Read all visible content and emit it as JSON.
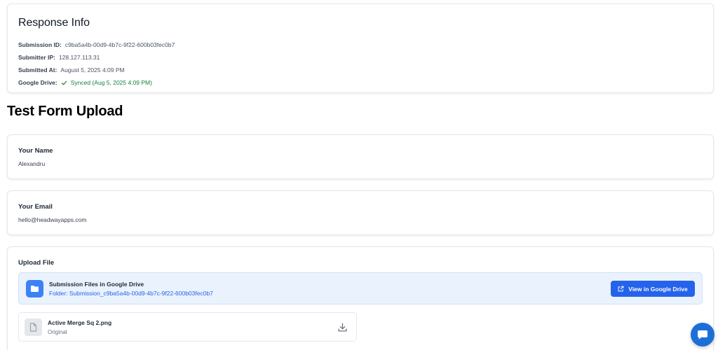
{
  "response_info": {
    "title": "Response Info",
    "rows": [
      {
        "label": "Submission ID:",
        "value": "c9ba5a4b-00d9-4b7c-9f22-600b03fec0b7"
      },
      {
        "label": "Submitter IP:",
        "value": "128.127.113.31"
      },
      {
        "label": "Submitted At:",
        "value": "August 5, 2025 4:09 PM"
      },
      {
        "label": "Google Drive:",
        "value": "Synced (Aug 5, 2025 4:09 PM)"
      }
    ]
  },
  "form": {
    "title": "Test Form Upload",
    "fields": [
      {
        "label": "Your Name",
        "value": "Alexandru"
      },
      {
        "label": "Your Email",
        "value": "hello@headwayapps.com"
      }
    ],
    "upload": {
      "label": "Upload File",
      "drive_title": "Submission Files in Google Drive",
      "drive_folder": "Folder: Submission_c9ba5a4b-00d9-4b7c-9f22-600b03fec0b7",
      "view_button": "View in Google Drive",
      "file_name": "Active Merge Sq 2.png",
      "file_variant": "Original"
    }
  },
  "icons": {
    "synced": "check-icon",
    "folder": "folder-icon",
    "external": "external-link-icon",
    "file": "file-icon",
    "download": "download-icon",
    "chat": "chat-icon"
  },
  "colors": {
    "accent": "#2563eb",
    "success": "#15803d",
    "drive_box_bg": "#eaf2fd",
    "chat_bubble": "#1d6fd8"
  }
}
